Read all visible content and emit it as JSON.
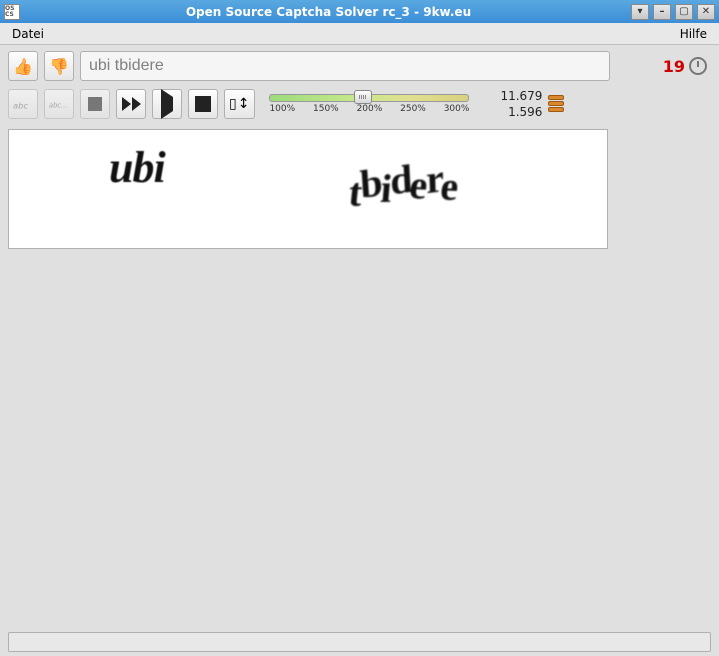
{
  "window": {
    "title": "Open Source Captcha Solver rc_3 - 9kw.eu",
    "app_icon_text": "OS CS"
  },
  "menu": {
    "file": "Datei",
    "help": "Hilfe"
  },
  "answer": {
    "value": "ubi tbidere"
  },
  "countdown": {
    "value": "19"
  },
  "slider": {
    "labels": [
      "100%",
      "150%",
      "200%",
      "250%",
      "300%"
    ]
  },
  "stats": {
    "points": "11.679",
    "credits": "1.596"
  },
  "captcha": {
    "word1": "ubi",
    "word2": "tbidere"
  },
  "statusbar": {
    "text": ""
  }
}
